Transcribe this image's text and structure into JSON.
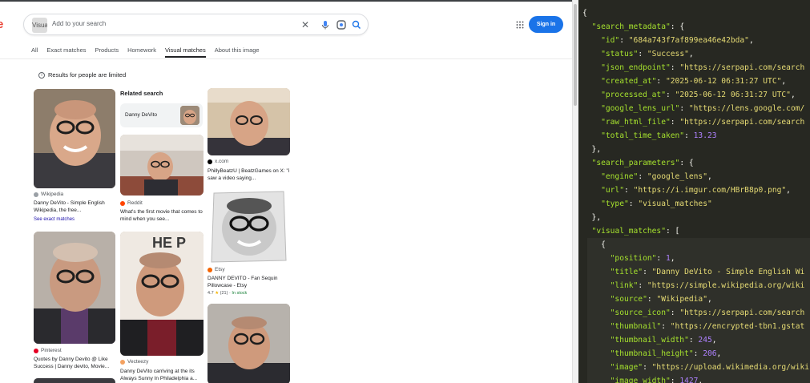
{
  "lens": {
    "logo_fragment": "e",
    "search": {
      "thumb_label": "Visual",
      "placeholder": "Add to your search"
    },
    "icons": {
      "clear": "close-icon",
      "mic": "mic-icon",
      "lens": "lens-icon",
      "search": "search-icon",
      "apps": "apps-grid-icon"
    },
    "signin_label": "Sign in",
    "tabs": [
      "All",
      "Exact matches",
      "Products",
      "Homework",
      "Visual matches",
      "About this image"
    ],
    "active_tab": "Visual matches",
    "notice": "Results for people are limited",
    "related": {
      "heading": "Related search",
      "chip_label": "Danny DeVito"
    },
    "results": [
      {
        "source": "Wikipedia",
        "title": "Danny DeVito - Simple English Wikipedia, the free...",
        "see_exact": "See exact matches"
      },
      {
        "source": "Reddit",
        "title": "What's the first movie that comes to mind when you see..."
      },
      {
        "source": "x.com",
        "title": "PhillyBeatzU | BeatzGames on X: \"i saw a video saying..."
      },
      {
        "source": "Etsy",
        "title": "DANNY DEVITO - Fan Sequin Pillowcase - Etsy",
        "rating": "4.7",
        "reviews": "(21)",
        "stock": "In stock"
      },
      {
        "source": "Pinterest",
        "title": "Quotes by Danny Devito @ Like Success | Danny devito, Movie..."
      },
      {
        "source": "Vecteezy",
        "title": "Danny DeVito carriving at the its Always Sunny In Philadelphia a..."
      }
    ]
  },
  "json_viewer": {
    "lines": [
      [
        [
          "p",
          "{"
        ]
      ],
      [
        [
          "p",
          "  "
        ],
        [
          "k",
          "\"search_metadata\""
        ],
        [
          "p",
          ": {"
        ]
      ],
      [
        [
          "p",
          "    "
        ],
        [
          "k",
          "\"id\""
        ],
        [
          "p",
          ": "
        ],
        [
          "s",
          "\"684a743f7af899ea46e42bda\""
        ],
        [
          "p",
          ","
        ]
      ],
      [
        [
          "p",
          "    "
        ],
        [
          "k",
          "\"status\""
        ],
        [
          "p",
          ": "
        ],
        [
          "s",
          "\"Success\""
        ],
        [
          "p",
          ","
        ]
      ],
      [
        [
          "p",
          "    "
        ],
        [
          "k",
          "\"json_endpoint\""
        ],
        [
          "p",
          ": "
        ],
        [
          "s",
          "\"https://serpapi.com/search"
        ]
      ],
      [
        [
          "p",
          "    "
        ],
        [
          "k",
          "\"created_at\""
        ],
        [
          "p",
          ": "
        ],
        [
          "s",
          "\"2025-06-12 06:31:27 UTC\""
        ],
        [
          "p",
          ","
        ]
      ],
      [
        [
          "p",
          "    "
        ],
        [
          "k",
          "\"processed_at\""
        ],
        [
          "p",
          ": "
        ],
        [
          "s",
          "\"2025-06-12 06:31:27 UTC\""
        ],
        [
          "p",
          ","
        ]
      ],
      [
        [
          "p",
          "    "
        ],
        [
          "k",
          "\"google_lens_url\""
        ],
        [
          "p",
          ": "
        ],
        [
          "s",
          "\"https://lens.google.com/"
        ]
      ],
      [
        [
          "p",
          "    "
        ],
        [
          "k",
          "\"raw_html_file\""
        ],
        [
          "p",
          ": "
        ],
        [
          "s",
          "\"https://serpapi.com/search"
        ]
      ],
      [
        [
          "p",
          "    "
        ],
        [
          "k",
          "\"total_time_taken\""
        ],
        [
          "p",
          ": "
        ],
        [
          "n",
          "13.23"
        ]
      ],
      [
        [
          "p",
          "  },"
        ]
      ],
      [
        [
          "p",
          "  "
        ],
        [
          "k",
          "\"search_parameters\""
        ],
        [
          "p",
          ": {"
        ]
      ],
      [
        [
          "p",
          "    "
        ],
        [
          "k",
          "\"engine\""
        ],
        [
          "p",
          ": "
        ],
        [
          "s",
          "\"google_lens\""
        ],
        [
          "p",
          ","
        ]
      ],
      [
        [
          "p",
          "    "
        ],
        [
          "k",
          "\"url\""
        ],
        [
          "p",
          ": "
        ],
        [
          "s",
          "\"https://i.imgur.com/HBrB8p0.png\""
        ],
        [
          "p",
          ","
        ]
      ],
      [
        [
          "p",
          "    "
        ],
        [
          "k",
          "\"type\""
        ],
        [
          "p",
          ": "
        ],
        [
          "s",
          "\"visual_matches\""
        ]
      ],
      [
        [
          "p",
          "  },"
        ]
      ],
      [
        [
          "p",
          "  "
        ],
        [
          "k",
          "\"visual_matches\""
        ],
        [
          "p",
          ": ["
        ]
      ],
      [
        [
          "p",
          "    {"
        ]
      ],
      [
        [
          "p",
          "      "
        ],
        [
          "k",
          "\"position\""
        ],
        [
          "p",
          ": "
        ],
        [
          "n",
          "1"
        ],
        [
          "p",
          ","
        ]
      ],
      [
        [
          "p",
          "      "
        ],
        [
          "k",
          "\"title\""
        ],
        [
          "p",
          ": "
        ],
        [
          "s",
          "\"Danny DeVito - Simple English Wi"
        ]
      ],
      [
        [
          "p",
          "      "
        ],
        [
          "k",
          "\"link\""
        ],
        [
          "p",
          ": "
        ],
        [
          "s",
          "\"https://simple.wikipedia.org/wiki"
        ]
      ],
      [
        [
          "p",
          "      "
        ],
        [
          "k",
          "\"source\""
        ],
        [
          "p",
          ": "
        ],
        [
          "s",
          "\"Wikipedia\""
        ],
        [
          "p",
          ","
        ]
      ],
      [
        [
          "p",
          "      "
        ],
        [
          "k",
          "\"source_icon\""
        ],
        [
          "p",
          ": "
        ],
        [
          "s",
          "\"https://serpapi.com/search"
        ]
      ],
      [
        [
          "p",
          "      "
        ],
        [
          "k",
          "\"thumbnail\""
        ],
        [
          "p",
          ": "
        ],
        [
          "s",
          "\"https://encrypted-tbn1.gstat"
        ]
      ],
      [
        [
          "p",
          "      "
        ],
        [
          "k",
          "\"thumbnail_width\""
        ],
        [
          "p",
          ": "
        ],
        [
          "n",
          "245"
        ],
        [
          "p",
          ","
        ]
      ],
      [
        [
          "p",
          "      "
        ],
        [
          "k",
          "\"thumbnail_height\""
        ],
        [
          "p",
          ": "
        ],
        [
          "n",
          "206"
        ],
        [
          "p",
          ","
        ]
      ],
      [
        [
          "p",
          "      "
        ],
        [
          "k",
          "\"image\""
        ],
        [
          "p",
          ": "
        ],
        [
          "s",
          "\"https://upload.wikimedia.org/wiki"
        ]
      ],
      [
        [
          "p",
          "      "
        ],
        [
          "k",
          "\"image_width\""
        ],
        [
          "p",
          ": "
        ],
        [
          "n",
          "1427"
        ],
        [
          "p",
          ","
        ]
      ]
    ]
  }
}
